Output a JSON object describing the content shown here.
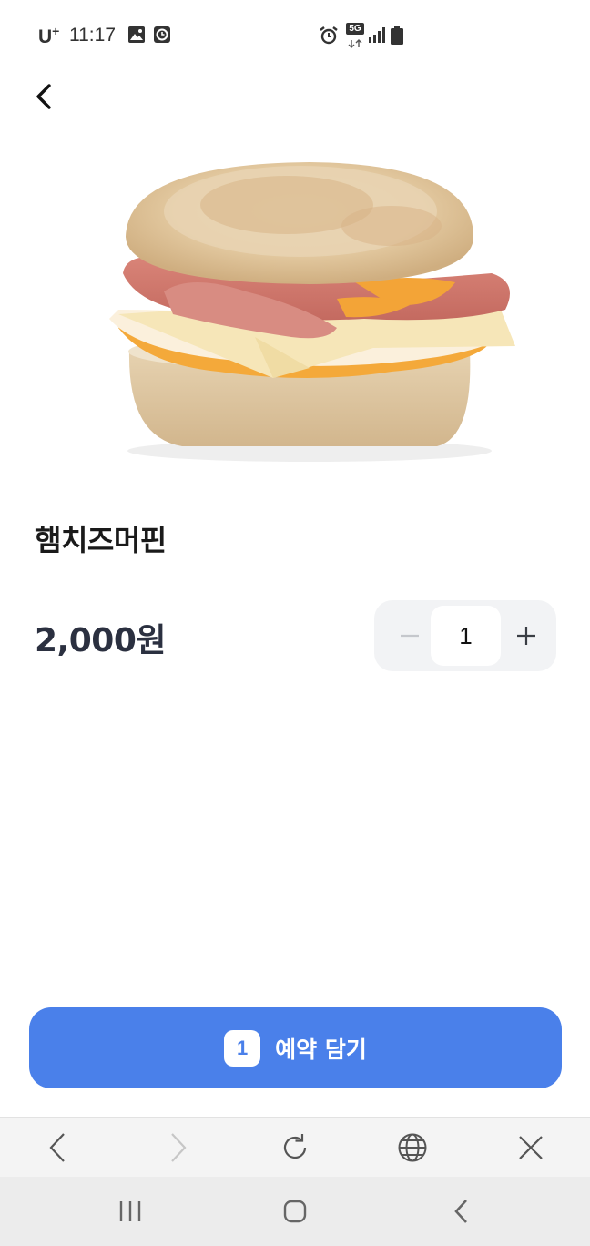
{
  "status_bar": {
    "carrier": "U",
    "carrier_sup": "+",
    "time": "11:17",
    "network": "5G",
    "icons": [
      "image-icon",
      "clock-app-icon",
      "alarm-icon",
      "5g-data-icon",
      "signal-icon",
      "battery-icon"
    ]
  },
  "header": {
    "back_icon": "chevron-left-icon"
  },
  "product": {
    "name": "햄치즈머핀",
    "price": "2,000원",
    "image": "ham-cheese-muffin-photo"
  },
  "stepper": {
    "minus_icon": "minus-icon",
    "quantity": "1",
    "plus_icon": "plus-icon"
  },
  "cart_button": {
    "count": "1",
    "label": "예약 담기"
  },
  "browser_toolbar": {
    "icons": [
      "browser-back-icon",
      "browser-forward-icon",
      "reload-icon",
      "globe-icon",
      "close-icon"
    ]
  },
  "nav_bar": {
    "icons": [
      "recent-apps-icon",
      "home-icon",
      "system-back-icon"
    ]
  },
  "colors": {
    "accent": "#4a80ea",
    "stepper_bg": "#f2f3f5",
    "price_text": "#2b3040"
  }
}
